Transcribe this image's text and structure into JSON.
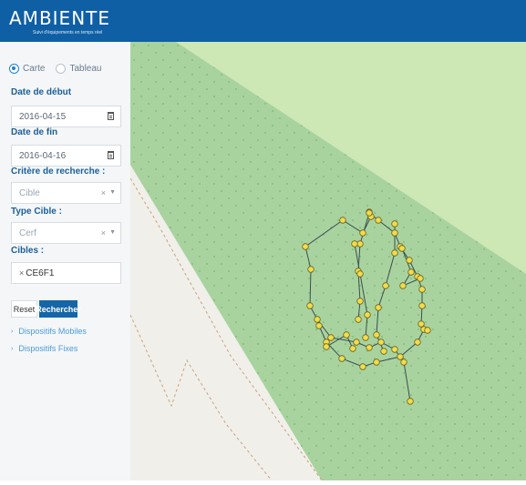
{
  "header": {
    "logo": "AMBIENTE",
    "tagline": "Suivi d'équipements en temps réel"
  },
  "sidebar": {
    "view_options": [
      {
        "label": "Carte",
        "checked": true
      },
      {
        "label": "Tableau",
        "checked": false
      }
    ],
    "start_date": {
      "label": "Date de début",
      "value": "2016-04-15",
      "icon": "calendar-icon"
    },
    "end_date": {
      "label": "Date de fin",
      "value": "2016-04-16",
      "icon": "calendar-icon"
    },
    "search_criteria": {
      "label": "Critère de recherche :",
      "value": "Cible"
    },
    "target_type": {
      "label": "Type Cible :",
      "value": "Cerf"
    },
    "targets": {
      "label": "Cibles :",
      "chip": "CE6F1"
    },
    "buttons": {
      "reset": "Reset",
      "search": "Rechercher"
    },
    "tree": {
      "mobile": "Dispositifs Mobiles",
      "fixed": "Dispositifs Fixes"
    }
  },
  "map": {
    "colors": {
      "land": "#f1efea",
      "forest": "#a8d39e",
      "meadow": "#cde8b4",
      "track": "#3b4d56",
      "marker": "#f2dc4a",
      "arrow": "#2a7fb4"
    }
  }
}
